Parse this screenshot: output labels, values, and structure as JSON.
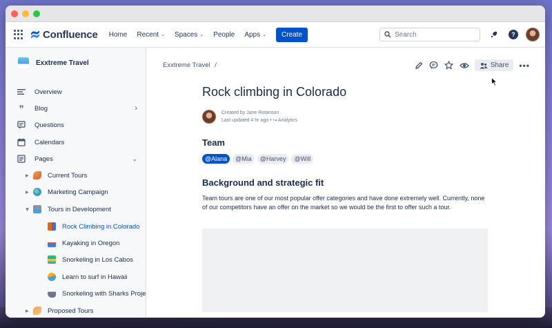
{
  "topnav": {
    "logo_text": "Confluence",
    "items": [
      {
        "label": "Home",
        "dropdown": false
      },
      {
        "label": "Recent",
        "dropdown": true
      },
      {
        "label": "Spaces",
        "dropdown": true
      },
      {
        "label": "People",
        "dropdown": false
      },
      {
        "label": "Apps",
        "dropdown": true
      }
    ],
    "create_label": "Create",
    "search_placeholder": "Search"
  },
  "sidebar": {
    "space_name": "Exxtreme Travel",
    "items": [
      {
        "label": "Overview",
        "icon": "overview-icon"
      },
      {
        "label": "Blog",
        "icon": "quote-icon"
      },
      {
        "label": "Questions",
        "icon": "questions-icon"
      },
      {
        "label": "Calendars",
        "icon": "calendar-icon"
      },
      {
        "label": "Pages",
        "icon": "pages-icon"
      }
    ],
    "tree": [
      {
        "label": "Current Tours",
        "emoji": "airplane-emoji",
        "color": "#e8893a"
      },
      {
        "label": "Marketing Campaign",
        "emoji": "globe-emoji",
        "color": "#3e9ad6"
      },
      {
        "label": "Tours in Development",
        "emoji": "construction-emoji",
        "color": "#8993a4"
      },
      {
        "label": "Rock Climbing in Colorado",
        "emoji": "climbing-emoji",
        "color": "#e56910",
        "active": true
      },
      {
        "label": "Kayaking in Oregon",
        "emoji": "kayak-emoji",
        "color": "#2684ff"
      },
      {
        "label": "Snorkeling in Los Cabos",
        "emoji": "beach-emoji",
        "color": "#36b37e"
      },
      {
        "label": "Learn to surf in Hawaii",
        "emoji": "surf-emoji",
        "color": "#ffab00"
      },
      {
        "label": "Snorkeling with Sharks Project",
        "emoji": "shark-emoji",
        "color": "#6b778c"
      },
      {
        "label": "Proposed Tours",
        "emoji": "plane-emoji",
        "color": "#e8893a"
      }
    ]
  },
  "page": {
    "breadcrumb": "Exxtreme Travel",
    "breadcrumb_sep": "/",
    "share_label": "Share",
    "title": "Rock climbing in Colorado",
    "created_by": "Created by Jane Rotanson",
    "last_updated": "Last updated 4 hr ago",
    "analytics_label": "Analytics",
    "team_heading": "Team",
    "mentions": [
      "@Alana",
      "@Mia",
      "@Harvey",
      "@Will"
    ],
    "bg_heading": "Background and strategic fit",
    "paragraph": "Team tours are one of our most popular offer categories and have done extremely well. Currently, none of our competitors have an offer on the market so we would be the first to offer such a tour."
  },
  "colors": {
    "brand": "#0052cc",
    "text": "#172b4d",
    "subtle": "#42526e"
  }
}
